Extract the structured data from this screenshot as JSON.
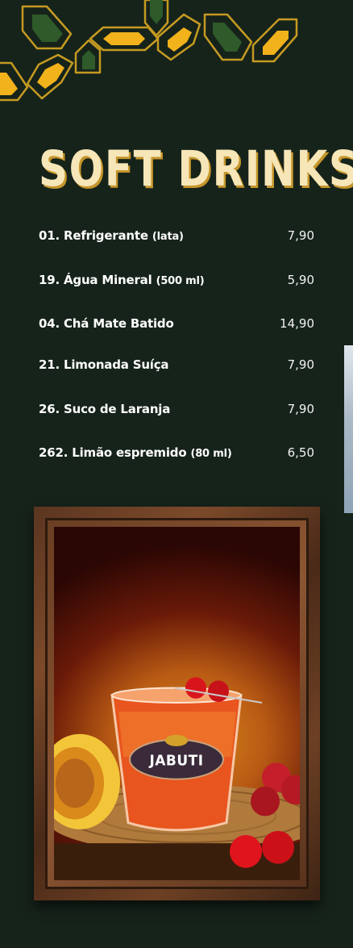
{
  "menu": {
    "title": "SOFT DRINKS",
    "items": [
      {
        "name": "01. Refrigerante",
        "note": "(lata)",
        "price": "7,90"
      },
      {
        "name": "19. Água Mineral",
        "note": "(500 ml)",
        "price": "5,90"
      },
      {
        "name": "04. Chá Mate Batido",
        "note": "",
        "price": "14,90"
      },
      {
        "name": "21. Limonada Suíça",
        "note": "",
        "price": "7,90"
      },
      {
        "name": "26. Suco de Laranja",
        "note": "",
        "price": "7,90"
      },
      {
        "name": "262. Limão espremido",
        "note": "(80 ml)",
        "price": "6,50"
      }
    ]
  },
  "photo": {
    "glass_logo": "JABUTI"
  },
  "colors": {
    "background": "#16231a",
    "title": "#f6e6b8",
    "title_shadow": "#c5952b",
    "pattern_gold": "#f1b21b",
    "pattern_green": "#2f5a2a"
  }
}
